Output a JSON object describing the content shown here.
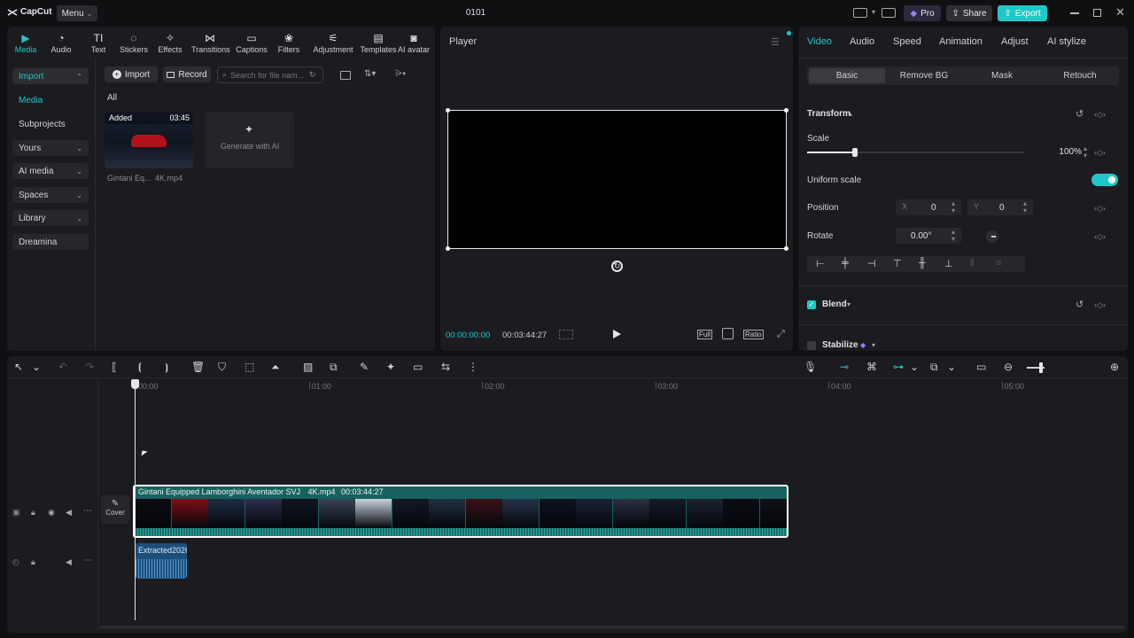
{
  "app": {
    "logo": "CapCut",
    "menu_label": "Menu",
    "project_title": "0101",
    "pro_label": "Pro",
    "share_label": "Share",
    "export_label": "Export"
  },
  "media_toolbar": [
    {
      "label": "Media",
      "icon": "media-icon",
      "active": true
    },
    {
      "label": "Audio",
      "icon": "audio-icon"
    },
    {
      "label": "Text",
      "icon": "text-icon"
    },
    {
      "label": "Stickers",
      "icon": "stickers-icon"
    },
    {
      "label": "Effects",
      "icon": "effects-icon"
    },
    {
      "label": "Transitions",
      "icon": "transitions-icon"
    },
    {
      "label": "Captions",
      "icon": "captions-icon"
    },
    {
      "label": "Filters",
      "icon": "filters-icon"
    },
    {
      "label": "Adjustment",
      "icon": "adjustment-icon"
    },
    {
      "label": "Templates",
      "icon": "templates-icon"
    },
    {
      "label": "AI avatar",
      "icon": "ai-avatar-icon"
    }
  ],
  "sidebar": [
    {
      "label": "Import",
      "chevron": "^",
      "active": true
    },
    {
      "label": "Media",
      "chevron": "",
      "sub": true
    },
    {
      "label": "Subprojects",
      "chevron": ""
    },
    {
      "label": "Yours",
      "chevron": "v"
    },
    {
      "label": "AI media",
      "chevron": "v"
    },
    {
      "label": "Spaces",
      "chevron": "v"
    },
    {
      "label": "Library",
      "chevron": "v"
    },
    {
      "label": "Dreamina",
      "chevron": ""
    }
  ],
  "media": {
    "import_label": "Import",
    "record_label": "Record",
    "search_placeholder": "Search for file nam...",
    "filter_all": "All",
    "item": {
      "badge": "Added",
      "duration": "03:45",
      "name_left": "Gintani Eq...",
      "name_right": "4K.mp4"
    },
    "generate_label": "Generate with AI"
  },
  "player": {
    "title": "Player",
    "current_time": "00:00:00:00",
    "total_time": "00:03:44:27",
    "full_label": "Full",
    "ratio_label": "Ratio"
  },
  "properties": {
    "tabs": [
      "Video",
      "Audio",
      "Speed",
      "Animation",
      "Adjust",
      "AI stylize"
    ],
    "subtabs": [
      "Basic",
      "Remove BG",
      "Mask",
      "Retouch"
    ],
    "transform_label": "Transform",
    "scale_label": "Scale",
    "scale_value": "100%",
    "scale_fraction": 0.22,
    "uniform_label": "Uniform scale",
    "uniform_on": true,
    "position_label": "Position",
    "pos_x_label": "X",
    "pos_x": "0",
    "pos_y_label": "Y",
    "pos_y": "0",
    "rotate_label": "Rotate",
    "rotate_value": "0.00°",
    "blend_label": "Blend",
    "stabilize_label": "Stabilize"
  },
  "timeline": {
    "ruler": [
      "00:00",
      "01:00",
      "02:00",
      "03:00",
      "04:00",
      "05:00"
    ],
    "video_clip": {
      "name": "Gintani Equipped Lamborghini Aventador SVJ",
      "ext": "4K.mp4",
      "duration": "00:03:44:27"
    },
    "cover_label": "Cover",
    "audio_clip": {
      "name": "Extracted2026"
    }
  },
  "colors": {
    "accent": "#1fc8c8",
    "pro": "#9b7df7",
    "clip": "#1a6e6a",
    "audio_clip": "#1d4f7a"
  }
}
